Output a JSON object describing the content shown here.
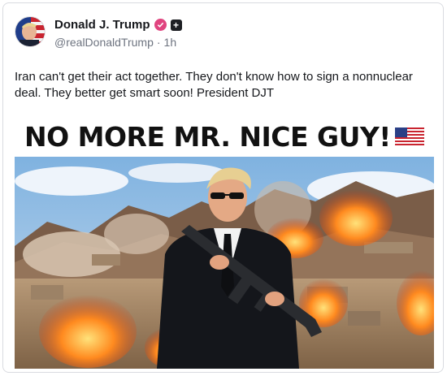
{
  "post": {
    "author_name": "Donald J. Trump",
    "handle": "@realDonaldTrump",
    "separator": "·",
    "time": "1h",
    "plus_glyph": "+",
    "text": "Iran can't get their act together. They don't know how to sign a nonnuclear deal. They better get smart soon! President DJT"
  },
  "media": {
    "headline": "NO MORE MR. NICE GUY!",
    "flag_icon": "us-flag-icon"
  },
  "icons": {
    "verified": "verified-badge-icon",
    "plus": "plus-badge-icon"
  },
  "colors": {
    "verified_badge": "#e0447f",
    "handle_text": "#6e7480",
    "card_border": "#d9dbe0"
  }
}
